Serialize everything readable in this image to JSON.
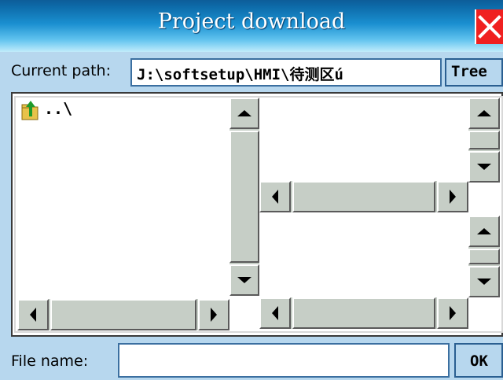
{
  "window": {
    "title": "Project download",
    "close_icon": "close-icon"
  },
  "path_bar": {
    "label": "Current path:",
    "value": "J:\\softsetup\\HMI\\待测区ú",
    "tree_button": "Tree"
  },
  "file_list": {
    "items": [
      {
        "icon": "folder-up-icon",
        "label": "..\\"
      }
    ]
  },
  "footer": {
    "file_name_label": "File name:",
    "file_name_value": "",
    "ok_button": "OK"
  },
  "colors": {
    "title_gradient_top": "#0d5d99",
    "title_gradient_bottom": "#a8e2f8",
    "dialog_background": "#b7d7ee",
    "close_button": "#f02020",
    "scrollbar": "#c6cec6"
  }
}
